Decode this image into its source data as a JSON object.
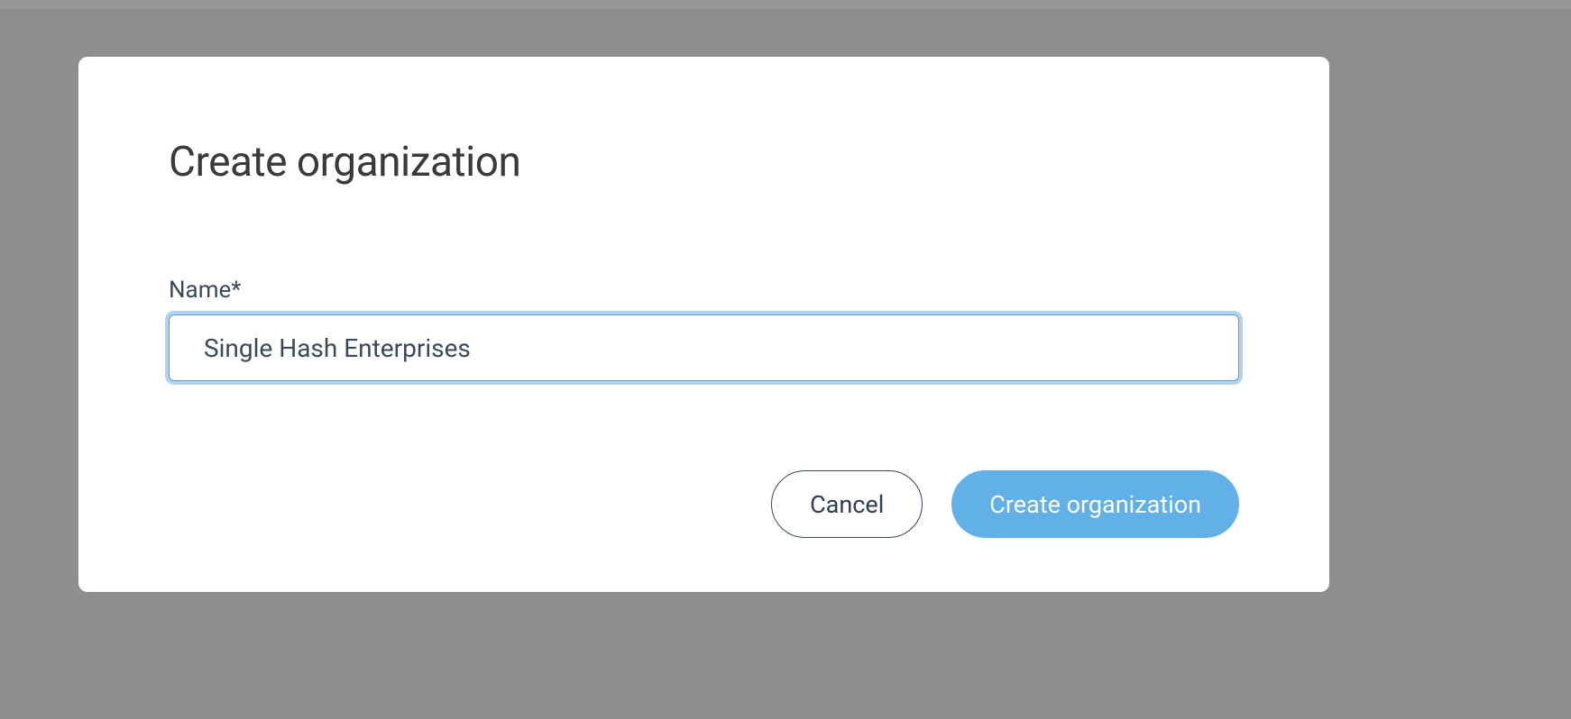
{
  "modal": {
    "title": "Create organization",
    "field": {
      "label": "Name*",
      "value": "Single Hash Enterprises"
    },
    "buttons": {
      "cancel": "Cancel",
      "submit": "Create organization"
    }
  }
}
